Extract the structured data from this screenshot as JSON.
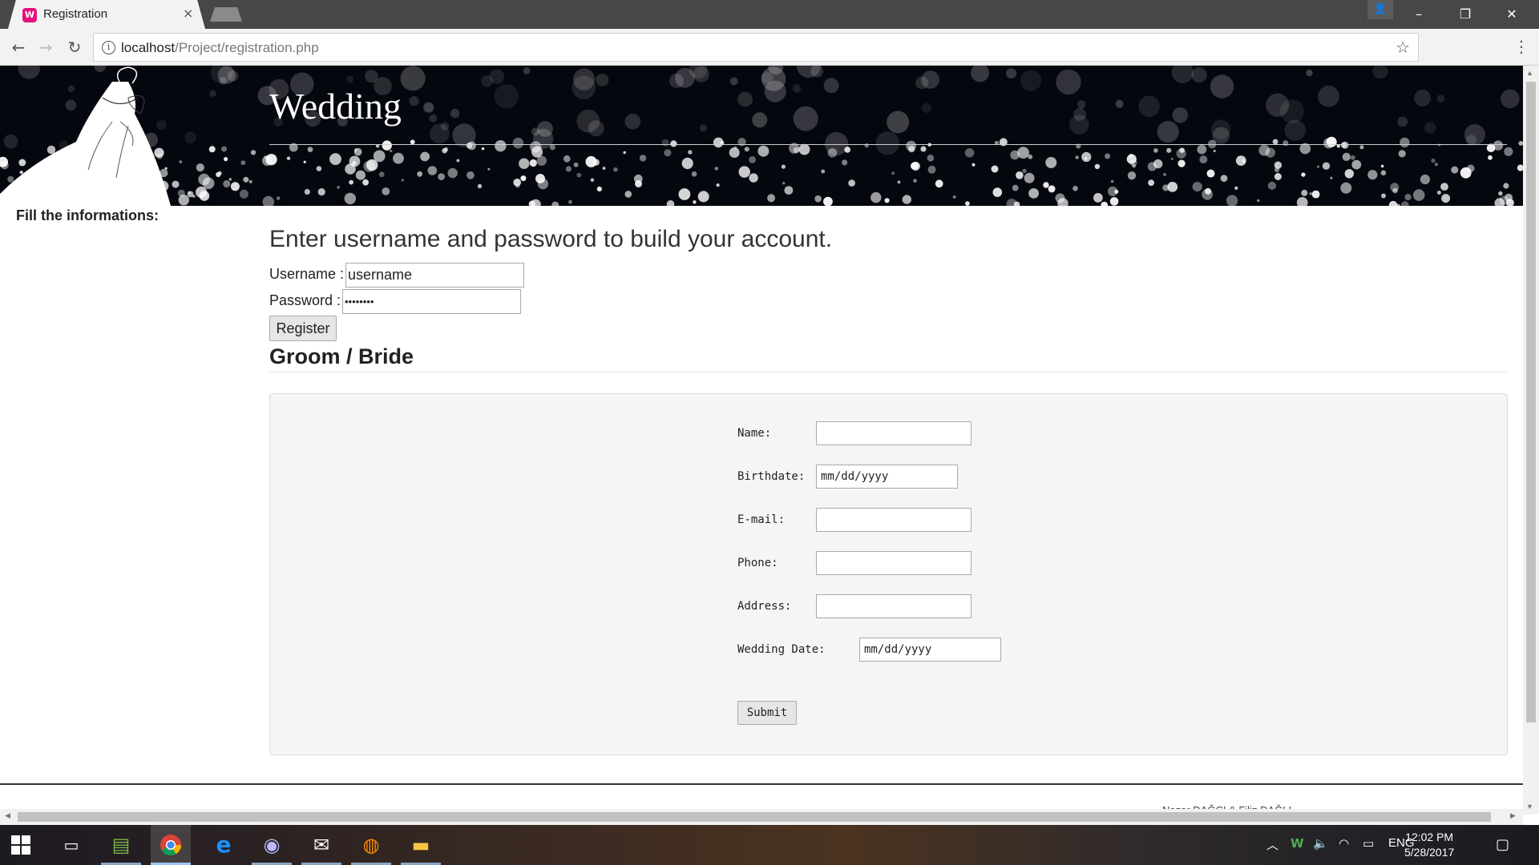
{
  "browser": {
    "tab_title": "Registration",
    "tab_close": "×",
    "favicon_letter": "W",
    "url_host": "localhost",
    "url_path": "/Project/registration.php",
    "window_controls": {
      "minimize": "–",
      "restore": "❐",
      "close": "✕"
    }
  },
  "page": {
    "banner_title": "Wedding",
    "sidebar_label": "Fill the informations:",
    "heading": "Enter username and password to build your account.",
    "username_label": "Username :",
    "username_value": "username",
    "password_label": "Password :",
    "password_value": "••••••••",
    "register_label": "Register",
    "section_heading": "Groom / Bride",
    "groom_form": {
      "name_label": "Name:",
      "birthdate_label": "Birthdate:",
      "birthdate_placeholder": "mm/dd/yyyy",
      "email_label": "E-mail:",
      "phone_label": "Phone:",
      "address_label": "Address:",
      "wedding_date_label": "Wedding Date:",
      "wedding_date_placeholder": "mm/dd/yyyy",
      "submit_label": "Submit"
    },
    "footer_text": "Nazar DAĞCI & Filiz DAĞLI"
  },
  "taskbar": {
    "language": "ENG",
    "time": "12:02 PM",
    "date": "5/28/2017"
  },
  "colors": {
    "banner_bg": "#05070f",
    "favicon": "#e6117d",
    "taskbar_accent": "#9fc4ef"
  }
}
